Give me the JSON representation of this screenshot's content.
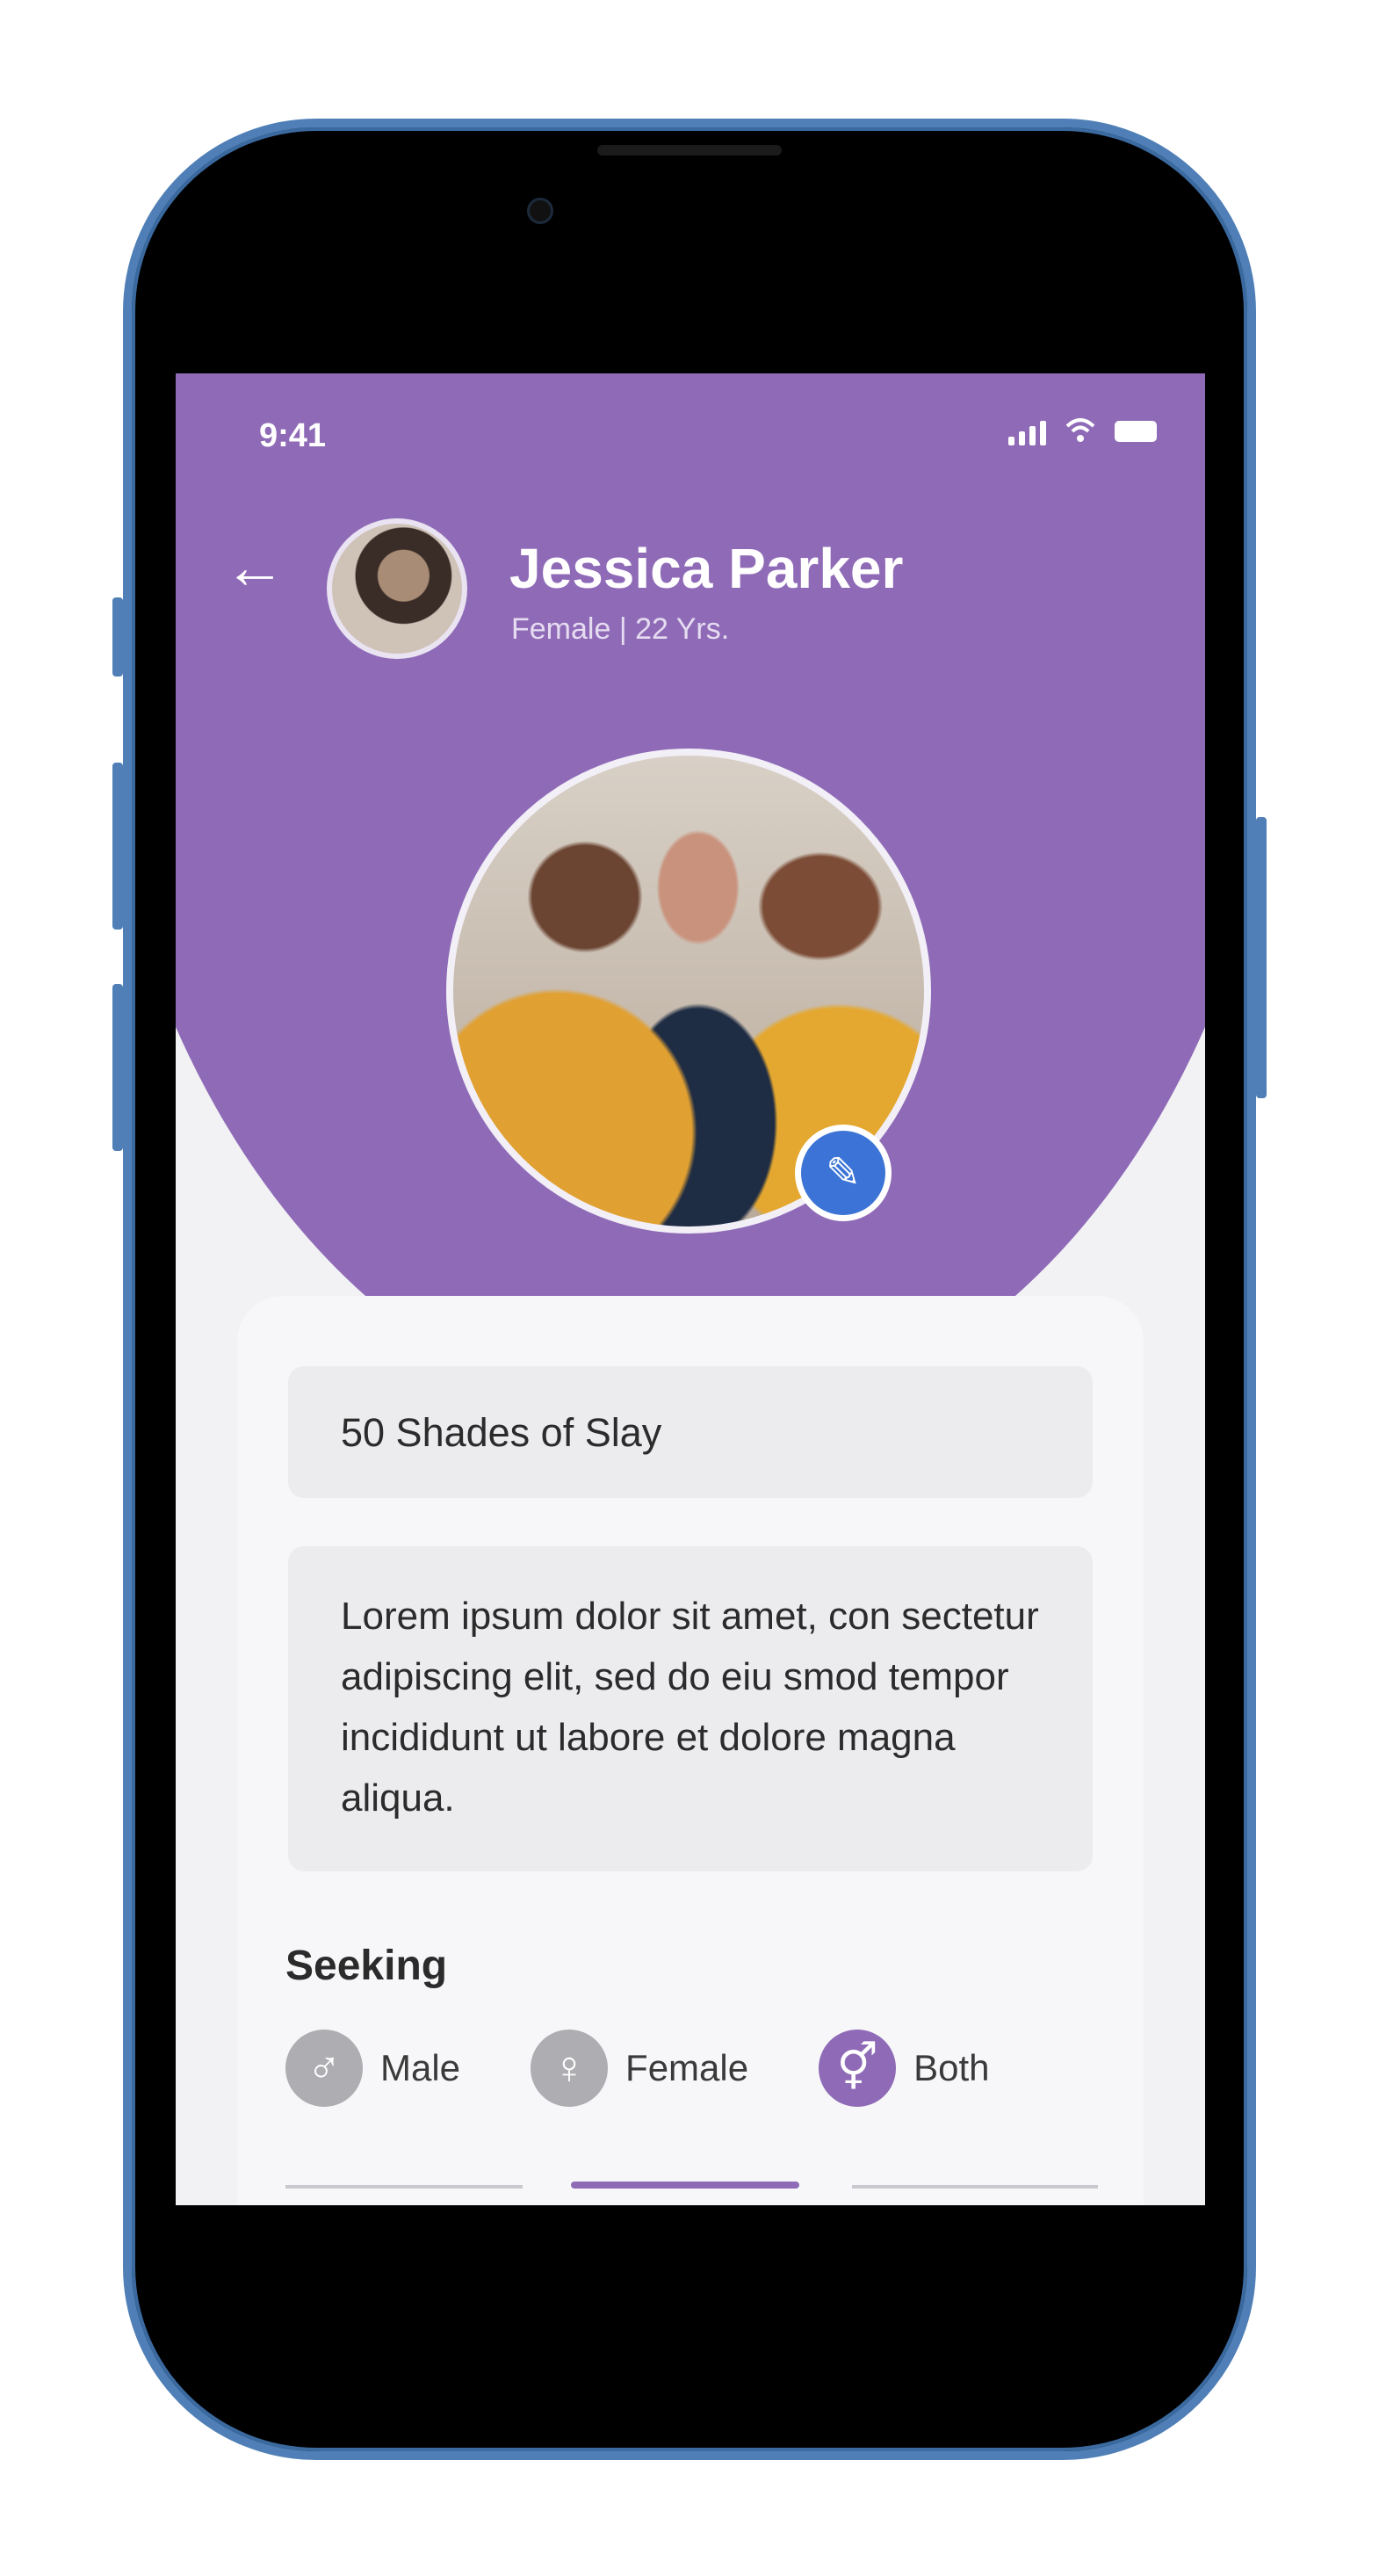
{
  "status_bar": {
    "time": "9:41"
  },
  "header": {
    "name": "Jessica Parker",
    "subtitle": "Female | 22 Yrs."
  },
  "profile": {
    "headline": "50 Shades of Slay",
    "bio": "Lorem ipsum dolor sit amet, con sectetur adipiscing elit, sed do eiu smod tempor incididunt ut labore et dolore magna aliqua."
  },
  "seeking": {
    "label": "Seeking",
    "options": [
      {
        "label": "Male",
        "selected": false,
        "icon": "male-symbol-icon"
      },
      {
        "label": "Female",
        "selected": false,
        "icon": "female-symbol-icon"
      },
      {
        "label": "Both",
        "selected": true,
        "icon": "both-genders-icon"
      }
    ]
  },
  "colors": {
    "accent": "#8f6bb7",
    "edit_button": "#3b74d6",
    "frame": "#4f7fb6"
  }
}
